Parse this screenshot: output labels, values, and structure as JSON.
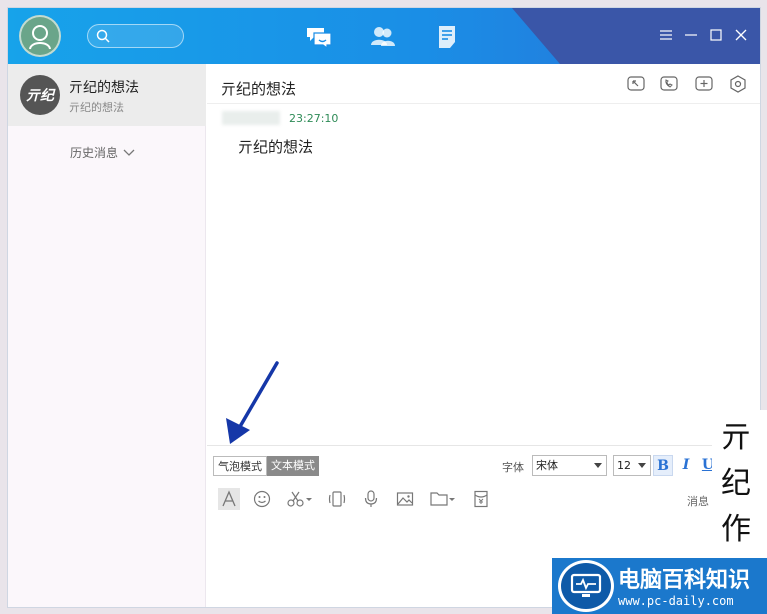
{
  "titlebar": {
    "search_placeholder": "",
    "nav": [
      "message-icon",
      "contacts-icon",
      "notes-icon"
    ]
  },
  "sidebar": {
    "contact": {
      "avatar_text": "亓纪",
      "name": "亓纪的想法",
      "last_message": "亓纪的想法"
    },
    "history_label": "历史消息"
  },
  "chat": {
    "title": "亓纪的想法",
    "messages": [
      {
        "time": "23:27:10",
        "text": "亓纪的想法"
      }
    ]
  },
  "toolbar": {
    "bubble_mode": "气泡模式",
    "text_mode": "文本模式",
    "font_label": "字体",
    "font_value": "宋体",
    "size_value": "12",
    "bold": "B",
    "italic": "I",
    "underline": "U",
    "message_record": "消息"
  },
  "watermark": {
    "text": "亓纪作"
  },
  "logo": {
    "title": "电脑百科知识",
    "url": "www.pc-daily.com"
  },
  "colors": {
    "titlebar": "#1a8ee6",
    "accent_dark": "#3a56a8",
    "time": "#2e8b57",
    "annotation_arrow": "#1537a8"
  }
}
